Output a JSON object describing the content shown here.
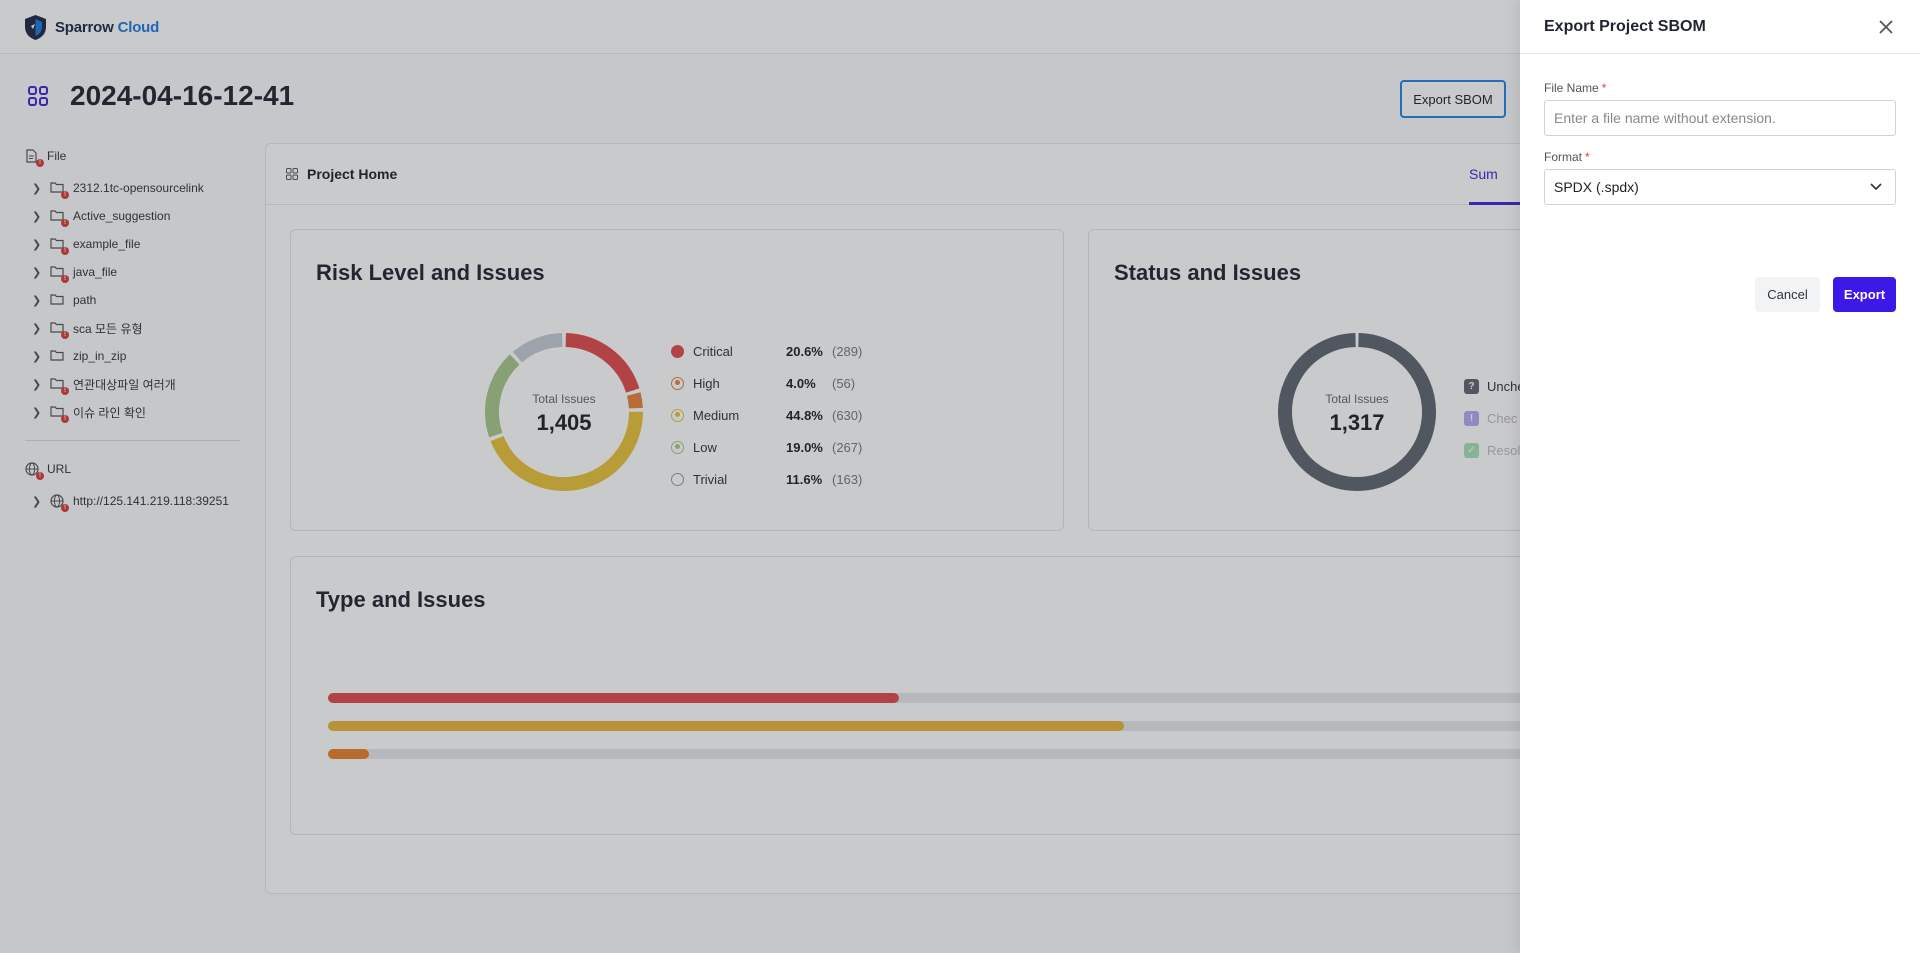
{
  "app": {
    "brand_main": "Sparrow",
    "brand_accent": "Cloud",
    "brand_color": "#1d7be0"
  },
  "page": {
    "title": "2024-04-16-12-41",
    "export_sbom_label": "Export SBOM"
  },
  "tree": {
    "file_root": "File",
    "files": [
      {
        "label": "2312.1tc-opensourcelink",
        "error": true
      },
      {
        "label": "Active_suggestion",
        "error": true
      },
      {
        "label": "example_file",
        "error": true
      },
      {
        "label": "java_file",
        "error": true
      },
      {
        "label": "path",
        "error": false
      },
      {
        "label": "sca 모든 유형",
        "error": true
      },
      {
        "label": "zip_in_zip",
        "error": false
      },
      {
        "label": "연관대상파일 여러개",
        "error": true
      },
      {
        "label": "이슈 라인 확인",
        "error": true
      }
    ],
    "url_root": "URL",
    "urls": [
      {
        "label": "http://125.141.219.118:39251",
        "error": true
      }
    ]
  },
  "main": {
    "header": "Project Home",
    "tab_summary": "Sum"
  },
  "risk": {
    "title": "Risk Level and Issues",
    "center_label": "Total Issues",
    "total": "1,405",
    "items": [
      {
        "label": "Critical",
        "pct": "20.6%",
        "count": "(289)",
        "color": "#e14b4b",
        "value": 289
      },
      {
        "label": "High",
        "pct": "4.0%",
        "count": "(56)",
        "color": "#e8823a",
        "value": 56
      },
      {
        "label": "Medium",
        "pct": "44.8%",
        "count": "(630)",
        "color": "#e8c23a",
        "value": 630
      },
      {
        "label": "Low",
        "pct": "19.0%",
        "count": "(267)",
        "color": "#a9c98a",
        "value": 267
      },
      {
        "label": "Trivial",
        "pct": "11.6%",
        "count": "(163)",
        "color": "#c4cbd6",
        "value": 163
      }
    ]
  },
  "status": {
    "title": "Status and Issues",
    "center_label": "Total Issues",
    "total": "1,317",
    "items": [
      {
        "label": "Unche",
        "color": "#5f6670",
        "glyph": "?"
      },
      {
        "label": "Chec",
        "color": "#b5a8f5",
        "glyph": "!"
      },
      {
        "label": "Resol",
        "color": "#a8e0b7",
        "glyph": "✓"
      }
    ]
  },
  "types": {
    "title": "Type and Issues",
    "bars": [
      {
        "fraction": 0.476,
        "color": "#e14b4b"
      },
      {
        "fraction": 0.663,
        "color": "#e8b53a"
      },
      {
        "fraction": 0.034,
        "color": "#e8822a"
      }
    ]
  },
  "drawer": {
    "title": "Export Project SBOM",
    "file_name_label": "File Name",
    "file_name_placeholder": "Enter a file name without extension.",
    "file_name_value": "",
    "format_label": "Format",
    "format_value": "SPDX (.spdx)",
    "cancel_label": "Cancel",
    "export_label": "Export",
    "accent": "#3d19e8"
  }
}
